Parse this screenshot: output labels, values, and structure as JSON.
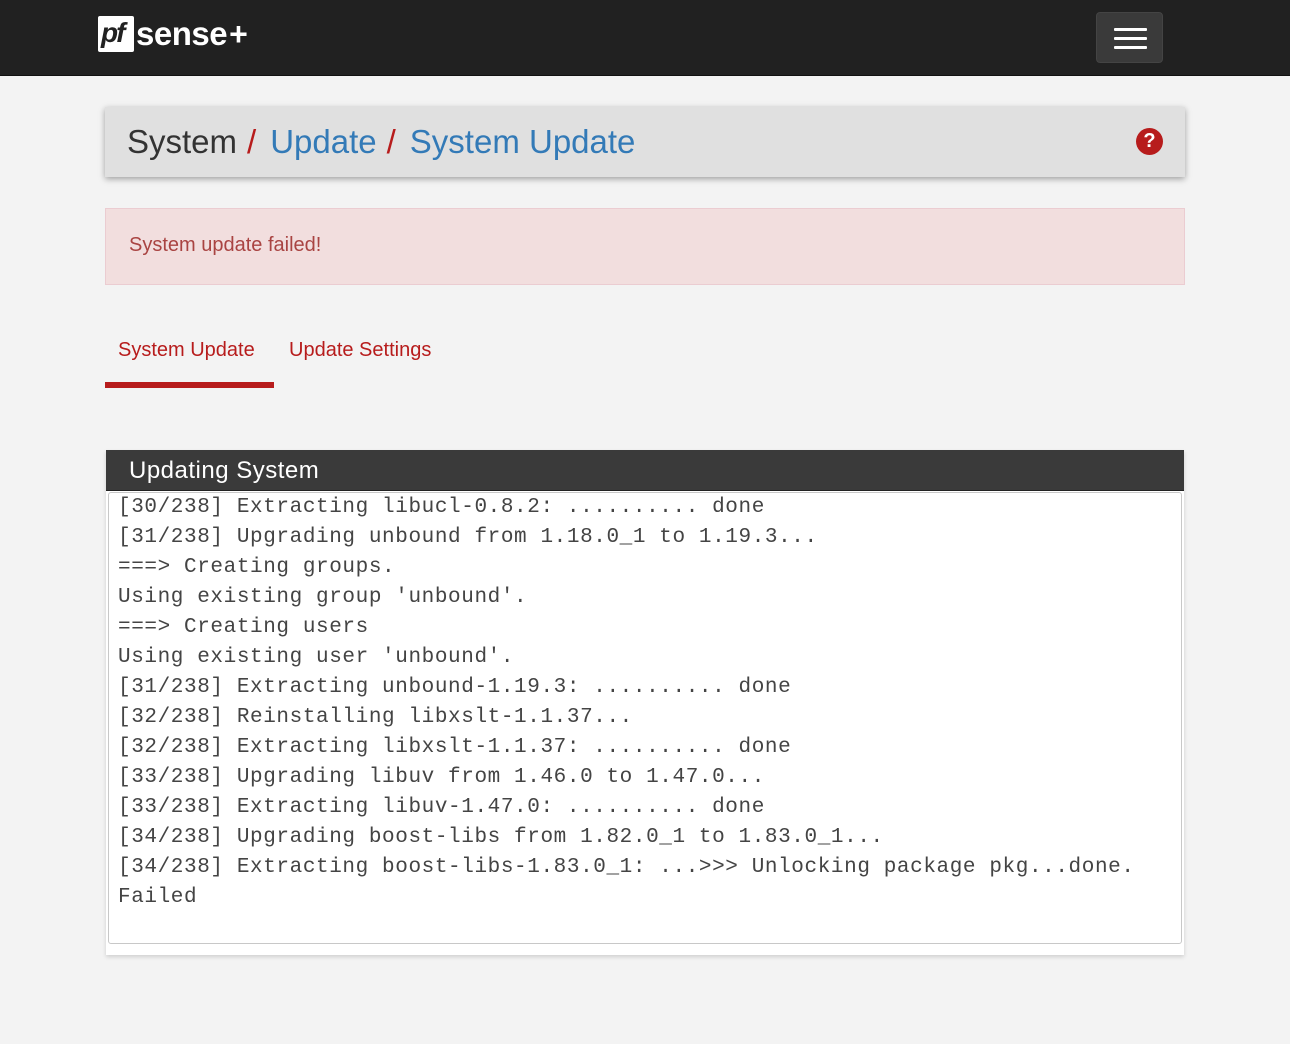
{
  "navbar": {
    "brand_pf": "pf",
    "brand_sense": "sense",
    "brand_plus": "+",
    "menu_icon": "hamburger-menu-icon"
  },
  "breadcrumb": {
    "items": [
      "System",
      "Update",
      "System Update"
    ],
    "separator": "/",
    "help_icon": "question-circle-icon"
  },
  "alert": {
    "message": "System update failed!"
  },
  "tabs": [
    {
      "label": "System Update",
      "active": true
    },
    {
      "label": "Update Settings",
      "active": false
    }
  ],
  "panel": {
    "title": "Updating System",
    "console_lines": [
      "[30/238] Extracting libucl-0.8.2: .......... done",
      "[31/238] Upgrading unbound from 1.18.0_1 to 1.19.3...",
      "===> Creating groups.",
      "Using existing group 'unbound'.",
      "===> Creating users",
      "Using existing user 'unbound'.",
      "[31/238] Extracting unbound-1.19.3: .......... done",
      "[32/238] Reinstalling libxslt-1.1.37...",
      "[32/238] Extracting libxslt-1.1.37: .......... done",
      "[33/238] Upgrading libuv from 1.46.0 to 1.47.0...",
      "[33/238] Extracting libuv-1.47.0: .......... done",
      "[34/238] Upgrading boost-libs from 1.82.0_1 to 1.83.0_1...",
      "[34/238] Extracting boost-libs-1.83.0_1: ...>>> Unlocking package pkg...done.",
      "Failed"
    ]
  },
  "colors": {
    "navbar_bg": "#212121",
    "accent_red": "#b71c1c",
    "link_blue": "#337ab7",
    "alert_bg": "#f2dede",
    "alert_text": "#a94442"
  }
}
